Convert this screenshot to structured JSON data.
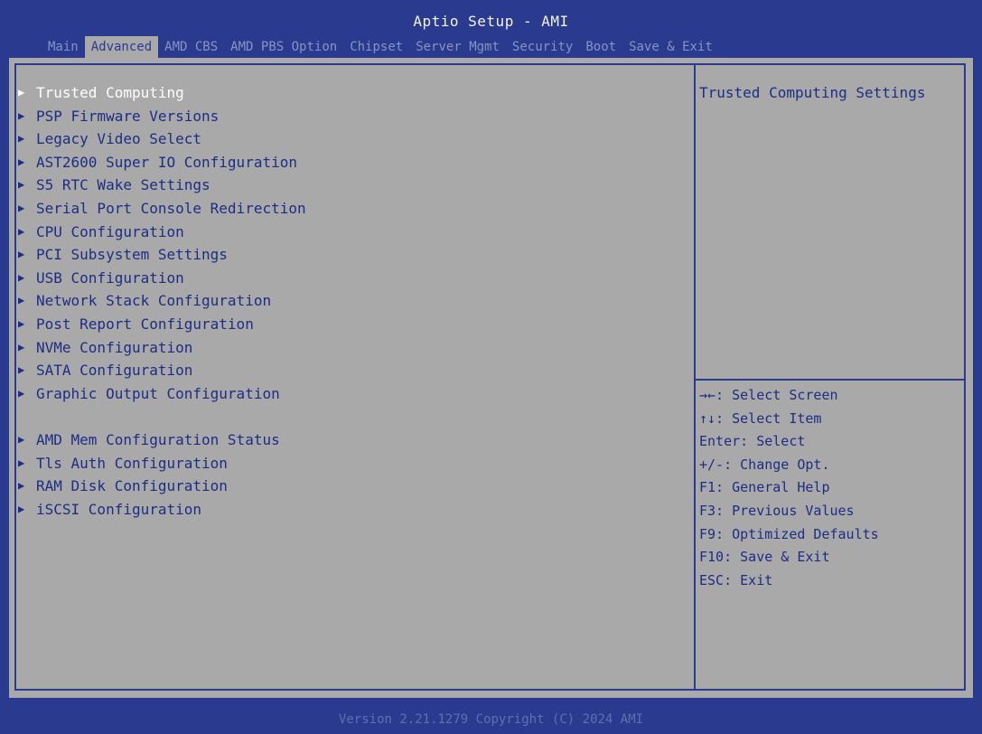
{
  "header": {
    "title": "Aptio Setup - AMI",
    "tabs": [
      "Main",
      "Advanced",
      "AMD CBS",
      "AMD PBS Option",
      "Chipset",
      "Server Mgmt",
      "Security",
      "Boot",
      "Save & Exit"
    ],
    "active_tab": "Advanced"
  },
  "menu": {
    "arrow_glyph": "▶",
    "items": [
      "Trusted Computing",
      "PSP Firmware Versions",
      "Legacy Video Select",
      "AST2600 Super IO Configuration",
      "S5 RTC Wake Settings",
      "Serial Port Console Redirection",
      "CPU Configuration",
      "PCI Subsystem Settings",
      "USB Configuration",
      "Network Stack Configuration",
      "Post Report Configuration",
      "NVMe Configuration",
      "SATA Configuration",
      "Graphic Output Configuration",
      "AMD Mem Configuration Status",
      "Tls Auth Configuration",
      "RAM Disk Configuration",
      "iSCSI Configuration"
    ],
    "selected_item": "Trusted Computing"
  },
  "help": {
    "text": "Trusted Computing Settings"
  },
  "keys": [
    "→←: Select Screen",
    "↑↓: Select Item",
    "Enter: Select",
    "+/-: Change Opt.",
    "F1: General Help",
    "F3: Previous Values",
    "F9: Optimized Defaults",
    "F10: Save & Exit",
    "ESC: Exit"
  ],
  "footer": {
    "version": "Version 2.21.1279 Copyright (C) 2024 AMI"
  },
  "colors": {
    "bios_blue": "#2a3b8f",
    "panel_gray": "#a9a9a9",
    "menu_text": "#1d2d85",
    "selected_text": "#ffffff"
  }
}
